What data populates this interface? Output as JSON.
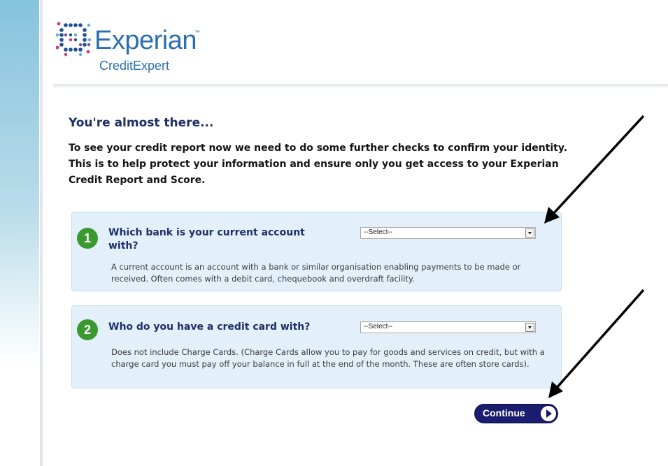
{
  "brand": {
    "name": "Experian",
    "tm": "™",
    "product": "CreditExpert"
  },
  "page": {
    "title": "You're almost there...",
    "intro": "To see your credit report now we need to do some further checks to confirm your identity. This is to help protect your information and ensure only you get access to your Experian Credit Report and Score."
  },
  "questions": [
    {
      "number": "1",
      "title": "Which bank is your current account with?",
      "select_value": "--Select--",
      "description": "A current account is an account with a bank or similar organisation enabling payments to be made or received. Often comes with a debit card, chequebook and overdraft facility."
    },
    {
      "number": "2",
      "title": "Who do you have a credit card with?",
      "select_value": "--Select--",
      "description": "Does not include Charge Cards. (Charge Cards allow you to pay for goods and services on credit, but with a charge card you must pay off your balance in full at the end of the month. These are often store cards)."
    }
  ],
  "actions": {
    "continue_label": "Continue"
  },
  "colors": {
    "brand_blue": "#2b6fb0",
    "heading_navy": "#1e2f66",
    "step_green": "#3a9a2f",
    "panel_bg": "#e3f0fa",
    "button_navy": "#1a1c6e"
  }
}
